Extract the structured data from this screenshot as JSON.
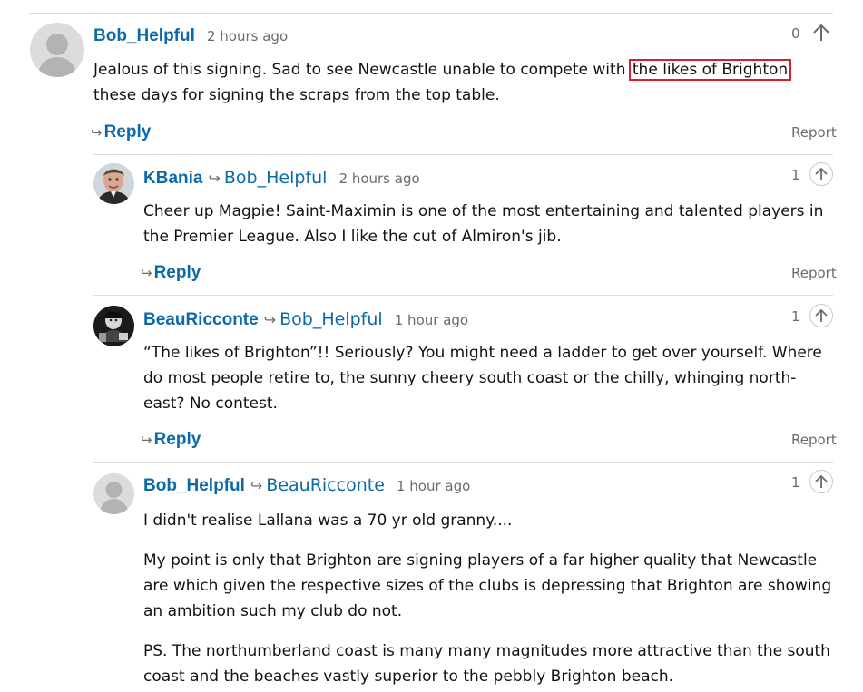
{
  "top_stub": "Reply",
  "comments": [
    {
      "author": "Bob_Helpful",
      "reply_to": "",
      "time": "2 hours ago",
      "votes": "0",
      "text_before": "Jealous of this signing. Sad to see Newcastle unable to compete with ",
      "text_highlight": "the likes of Brighton",
      "text_after": " these days for signing the scraps from the top table.",
      "reply_label": "Reply",
      "report_label": "Report"
    },
    {
      "author": "KBania",
      "reply_to": "Bob_Helpful",
      "time": "2 hours ago",
      "votes": "1",
      "text": "Cheer up Magpie! Saint-Maximin is one of the most entertaining and talented players in the Premier League. Also I like the cut of Almiron's jib.",
      "reply_label": "Reply",
      "report_label": "Report"
    },
    {
      "author": "BeauRicconte",
      "reply_to": "Bob_Helpful",
      "time": "1 hour ago",
      "votes": "1",
      "text": "“The likes of Brighton”!! Seriously? You might need a ladder to get over yourself. Where do most people retire to, the sunny cheery south coast or the chilly, whinging north-east? No contest.",
      "reply_label": "Reply",
      "report_label": "Report"
    },
    {
      "author": "Bob_Helpful",
      "reply_to": "BeauRicconte",
      "time": "1 hour ago",
      "votes": "1",
      "paragraphs": [
        "I didn't realise Lallana was a 70 yr old granny....",
        "My point is only that Brighton are signing players of a far higher quality that Newcastle are which given the respective sizes of the clubs is depressing that Brighton are showing an ambition such my club do not.",
        "PS. The northumberland coast is many many magnitudes more attractive than the south coast and the beaches vastly superior to the pebbly Brighton beach."
      ]
    }
  ],
  "reply_arrow": "↪",
  "colors": {
    "author": "#0c6aa8",
    "highlight_border": "#d6212d",
    "muted": "#6b6b6b",
    "divider": "#dcdcdc"
  },
  "icons": {
    "recommend": "arrow-up-icon",
    "default_avatar": "user-silhouette-icon"
  }
}
